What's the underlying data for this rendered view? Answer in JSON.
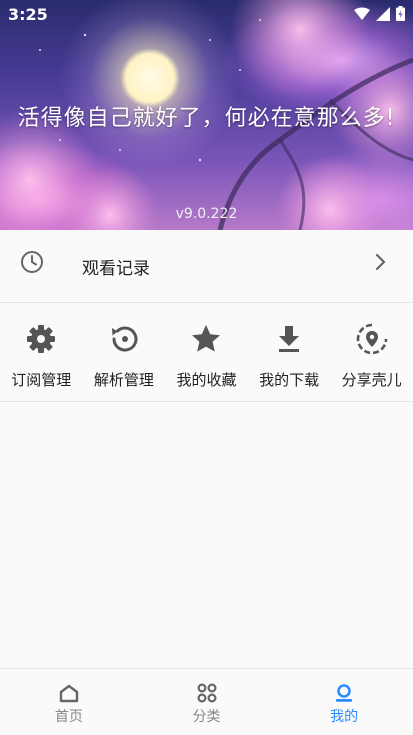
{
  "status_bar": {
    "time": "3:25"
  },
  "hero": {
    "motto": "活得像自己就好了，何必在意那么多!",
    "version": "v9.0.222"
  },
  "history": {
    "label": "观看记录"
  },
  "actions": [
    {
      "label": "订阅管理",
      "icon": "gear-icon"
    },
    {
      "label": "解析管理",
      "icon": "restore-icon"
    },
    {
      "label": "我的收藏",
      "icon": "star-icon"
    },
    {
      "label": "我的下载",
      "icon": "download-icon"
    },
    {
      "label": "分享壳儿",
      "icon": "location-share-icon"
    }
  ],
  "bottom_nav": {
    "items": [
      {
        "label": "首页",
        "icon": "home-icon",
        "active": false
      },
      {
        "label": "分类",
        "icon": "grid-icon",
        "active": false
      },
      {
        "label": "我的",
        "icon": "user-icon",
        "active": true
      }
    ],
    "active_color": "#2a8cff",
    "inactive_color": "#888888"
  },
  "colors": {
    "icon_gray": "#555555",
    "accent": "#2a8cff"
  }
}
